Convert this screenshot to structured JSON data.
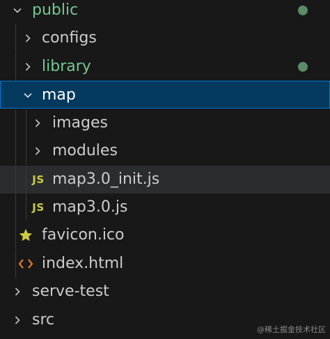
{
  "explorer": {
    "items": [
      {
        "label": "public",
        "type": "folder",
        "expanded": true,
        "git_status": "modified"
      },
      {
        "label": "configs",
        "type": "folder",
        "expanded": false
      },
      {
        "label": "library",
        "type": "folder",
        "expanded": false,
        "git_status": "untracked"
      },
      {
        "label": "map",
        "type": "folder",
        "expanded": true,
        "selected": true
      },
      {
        "label": "images",
        "type": "folder",
        "expanded": false
      },
      {
        "label": "modules",
        "type": "folder",
        "expanded": false
      },
      {
        "label": "map3.0_init.js",
        "type": "file",
        "icon": "js-icon",
        "icon_text": "JS",
        "hovered": true
      },
      {
        "label": "map3.0.js",
        "type": "file",
        "icon": "js-icon",
        "icon_text": "JS"
      },
      {
        "label": "favicon.ico",
        "type": "file",
        "icon": "star-icon"
      },
      {
        "label": "index.html",
        "type": "file",
        "icon": "html-icon"
      },
      {
        "label": "serve-test",
        "type": "folder",
        "expanded": false
      },
      {
        "label": "src",
        "type": "folder",
        "expanded": false
      }
    ]
  },
  "colors": {
    "background": "#181818",
    "selected_bg": "#04395e",
    "selected_border": "#0078d4",
    "hover_bg": "#2a2d2e",
    "git_modified_text": "#73c991",
    "js_icon": "#cbcb41",
    "star_icon": "#cbcb41",
    "html_icon": "#e37933"
  },
  "watermark": "@稀土掘金技术社区"
}
